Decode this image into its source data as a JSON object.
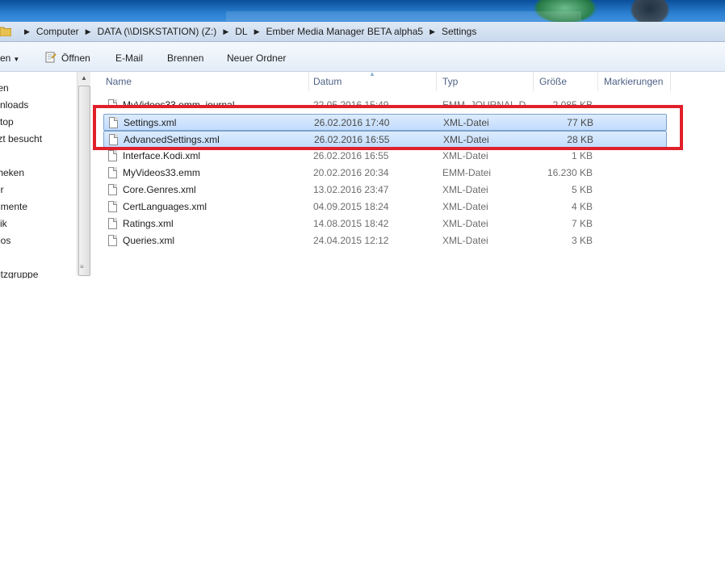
{
  "address_bar": {
    "crumbs": [
      "Computer",
      "DATA (\\\\DISKSTATION) (Z:)",
      "DL",
      "Ember Media Manager BETA alpha5",
      "Settings"
    ]
  },
  "toolbar": {
    "organize_label": "en",
    "open_label": "Öffnen",
    "email_label": "E-Mail",
    "burn_label": "Brennen",
    "new_folder_label": "Neuer Ordner"
  },
  "nav_pane": {
    "items": [
      "ten",
      "vnloads",
      "ktop",
      "tzt besucht",
      "theken",
      "er",
      "umente",
      "sik",
      "eos",
      "etzgruppe"
    ]
  },
  "columns": {
    "name": "Name",
    "date": "Datum",
    "type": "Typ",
    "size": "Größe",
    "tags": "Markierungen"
  },
  "files": [
    {
      "name": "MyVideos33.emm_journal",
      "date": "22.05.2016 15:49",
      "type": "EMM_JOURNAL-D...",
      "size": "2.085 KB"
    },
    {
      "name": "Settings.xml",
      "date": "26.02.2016 17:40",
      "type": "XML-Datei",
      "size": "77 KB"
    },
    {
      "name": "AdvancedSettings.xml",
      "date": "26.02.2016 16:55",
      "type": "XML-Datei",
      "size": "28 KB"
    },
    {
      "name": "Interface.Kodi.xml",
      "date": "26.02.2016 16:55",
      "type": "XML-Datei",
      "size": "1 KB"
    },
    {
      "name": "MyVideos33.emm",
      "date": "20.02.2016 20:34",
      "type": "EMM-Datei",
      "size": "16.230 KB"
    },
    {
      "name": "Core.Genres.xml",
      "date": "13.02.2016 23:47",
      "type": "XML-Datei",
      "size": "5 KB"
    },
    {
      "name": "CertLanguages.xml",
      "date": "04.09.2015 18:24",
      "type": "XML-Datei",
      "size": "4 KB"
    },
    {
      "name": "Ratings.xml",
      "date": "14.08.2015 18:42",
      "type": "XML-Datei",
      "size": "7 KB"
    },
    {
      "name": "Queries.xml",
      "date": "24.04.2015 12:12",
      "type": "XML-Datei",
      "size": "3 KB"
    }
  ],
  "colors": {
    "highlight_border": "#e0202a",
    "selection_fill": "#cce4fd",
    "selection_border": "#7da2ce",
    "header_text": "#4d6185"
  }
}
